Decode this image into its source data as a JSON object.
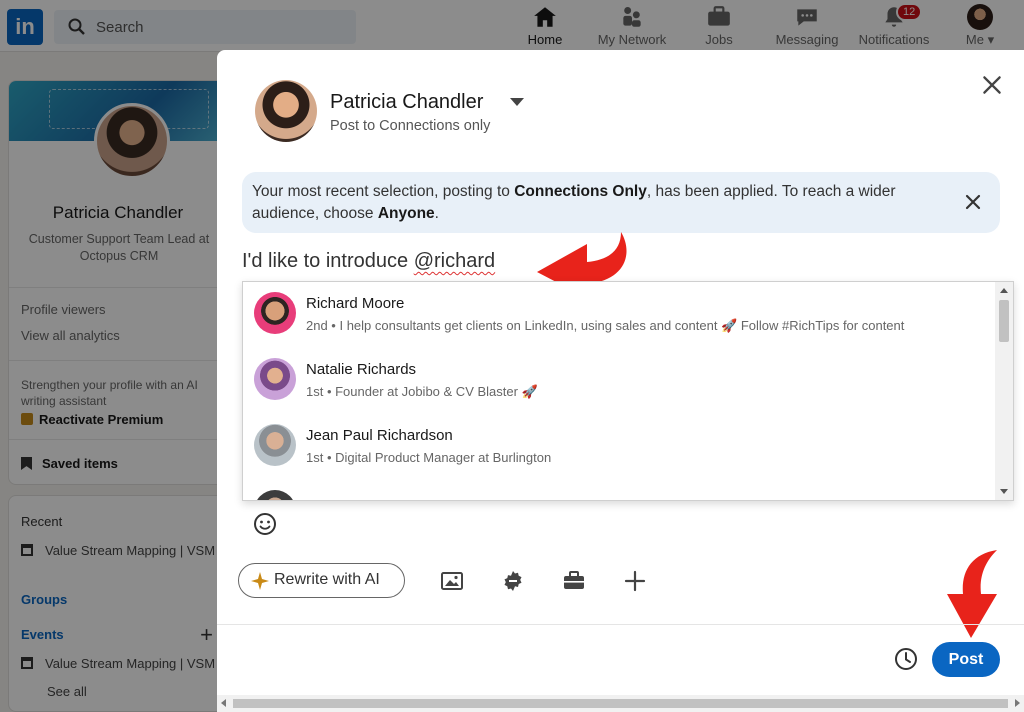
{
  "nav": {
    "logo": "in",
    "search_placeholder": "Search",
    "items": [
      {
        "label": "Home",
        "icon": "home-icon"
      },
      {
        "label": "My Network",
        "icon": "network-icon"
      },
      {
        "label": "Jobs",
        "icon": "briefcase-icon"
      },
      {
        "label": "Messaging",
        "icon": "messaging-icon"
      },
      {
        "label": "Notifications",
        "icon": "bell-icon",
        "badge": "12"
      },
      {
        "label": "Me",
        "icon": "avatar"
      }
    ]
  },
  "sidebar": {
    "name": "Patricia Chandler",
    "headline": "Customer Support Team Lead at Octopus CRM",
    "profile_viewers": "Profile viewers",
    "analytics": "View all analytics",
    "premium_prompt": "Strengthen your profile with an AI writing assistant",
    "premium_cta": "Reactivate Premium",
    "saved": "Saved items",
    "recent_title": "Recent",
    "recent_item": "Value Stream Mapping | VSM",
    "groups": "Groups",
    "events": "Events",
    "events_item": "Value Stream Mapping | VSM",
    "see_all": "See all"
  },
  "modal": {
    "author_name": "Patricia Chandler",
    "visibility": "Post to Connections only",
    "notice_part1": "Your most recent selection, posting to ",
    "notice_bold1": "Connections Only",
    "notice_part2": ", has been applied. To reach a wider audience, choose ",
    "notice_bold2": "Anyone",
    "notice_part3": ".",
    "composer_text": "I'd like to introduce ",
    "composer_mention": "@richard",
    "suggestions": [
      {
        "name": "Richard Moore",
        "subtitle": "2nd • I help consultants get clients on LinkedIn, using sales and content 🚀 Follow #RichTips for content"
      },
      {
        "name": "Natalie Richards",
        "subtitle": "1st • Founder at Jobibo & CV Blaster 🚀"
      },
      {
        "name": "Jean Paul Richardson",
        "subtitle": "1st • Digital Product Manager at Burlington"
      }
    ],
    "ai_button": "Rewrite with AI",
    "post_button": "Post"
  },
  "colors": {
    "brand": "#0a66c2",
    "arrow": "#e8231b",
    "notice_bg": "#e8f0f8"
  }
}
